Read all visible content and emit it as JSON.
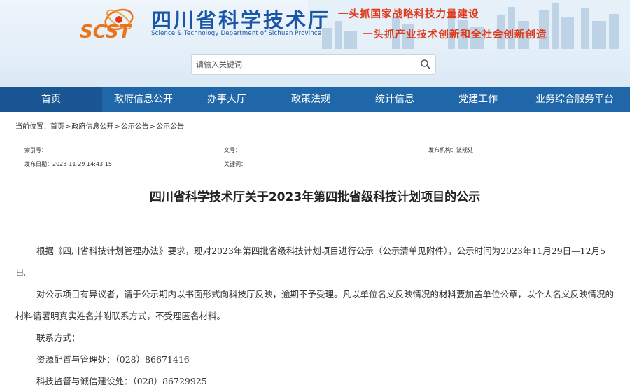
{
  "header": {
    "site_title": "四川省科学技术厅",
    "site_subtitle": "Science & Technology Department of Sichuan Province",
    "logo_text": "SCST",
    "slogan_line1": "一头抓国家战略科技力量建设",
    "slogan_line2": "一头抓产业技术创新和全社会创新创造"
  },
  "search": {
    "placeholder": "请输入关键词"
  },
  "nav": {
    "items": [
      {
        "label": "首页"
      },
      {
        "label": "政府信息公开"
      },
      {
        "label": "办事大厅"
      },
      {
        "label": "政策法规"
      },
      {
        "label": "统计信息"
      },
      {
        "label": "党建工作"
      },
      {
        "label": "业务综合服务平台"
      }
    ]
  },
  "breadcrumb": {
    "label": "当前位置：",
    "items": [
      "首页",
      "政府信息公开",
      "公示公告",
      "公示公告"
    ],
    "separator": ">"
  },
  "meta": {
    "index_label": "索引号：",
    "index_value": "",
    "doc_no_label": "文号：",
    "doc_no_value": "",
    "publisher_label": "发布机构：",
    "publisher_value": "法规处",
    "date_label": "发布日期：",
    "date_value": "2023-11-29 14:43:15",
    "keywords_label": "关键词：",
    "keywords_value": ""
  },
  "article": {
    "title": "四川省科学技术厅关于2023年第四批省级科技计划项目的公示",
    "para1": "根据《四川省科技计划管理办法》要求，现对2023年第四批省级科技计划项目进行公示（公示清单见附件），公示时间为2023年11月29日—12月5日。",
    "para2": "对公示项目有异议者，请于公示期内以书面形式向科技厅反映，逾期不予受理。凡以单位名义反映情况的材料要加盖单位公章，以个人名义反映情况的材料请署明真实姓名并附联系方式，不受理匿名材料。",
    "contact_label": "联系方式：",
    "contact1": "资源配置与管理处：（028）86671416",
    "contact2": "科技监督与诚信建设处：（028）86729925"
  },
  "colors": {
    "nav_bg": "#1f67a8",
    "nav_active_bg": "#1a5594",
    "brand_blue": "#1a56a6",
    "slogan_red": "#e03a1e"
  },
  "icons": {
    "search": "search-icon",
    "logo": "scst-logo-icon"
  }
}
